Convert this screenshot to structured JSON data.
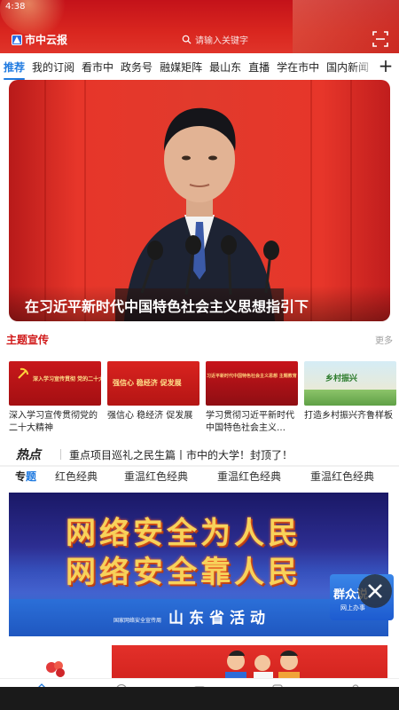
{
  "status_bar": {
    "time": "4:38"
  },
  "header": {
    "app_name": "市中云报",
    "search_placeholder": "请输入关键字"
  },
  "tabs": [
    {
      "label": "推荐",
      "active": true
    },
    {
      "label": "我的订阅"
    },
    {
      "label": "看市中"
    },
    {
      "label": "政务号"
    },
    {
      "label": "融媒矩阵"
    },
    {
      "label": "最山东"
    },
    {
      "label": "直播"
    },
    {
      "label": "学在市中"
    },
    {
      "label": "国内新闻"
    }
  ],
  "hero": {
    "caption": "在习近平新时代中国特色社会主义思想指引下"
  },
  "theme_section": {
    "title": "主题宣传",
    "more": "更多",
    "cards": [
      {
        "title": "深入学习宣传贯彻党的二十大精神",
        "thumb_text": "深入学习宣传贯彻 党的二十大精神"
      },
      {
        "title": "强信心 稳经济 促发展",
        "thumb_text": "强信心 稳经济 促发展"
      },
      {
        "title": "学习贯彻习近平新时代中国特色社会主义…",
        "thumb_text": "习近平新时代中国特色社会主义思想 主题教育"
      },
      {
        "title": "打造乡村振兴齐鲁样板",
        "thumb_text": "乡村振兴"
      }
    ]
  },
  "hot": {
    "label": "热点",
    "text": "重点项目巡礼之民生篇丨市中的大学！封顶了！"
  },
  "topics": {
    "label_part1": "专",
    "label_part2": "题",
    "items": [
      "红色经典",
      "重温红色经典",
      "重温红色经典",
      "重温红色经典"
    ]
  },
  "banner": {
    "line1": "网络安全为人民",
    "line2": "网络安全靠人民",
    "activity": "山东省活动",
    "org": "国家网络安全宣传周"
  },
  "float_ad": {
    "text": "群众说",
    "sub": "网上办事"
  }
}
